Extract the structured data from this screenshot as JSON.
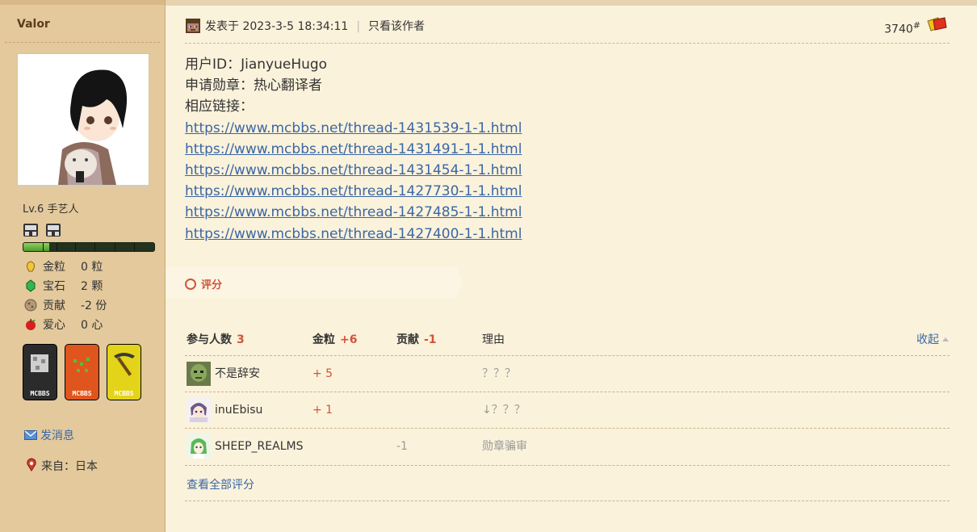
{
  "sidebar": {
    "username": "Valor",
    "level": "Lv.6 手艺人",
    "xp_progress": 0.2,
    "stats": [
      {
        "icon": "gold-nugget-icon",
        "label": "金粒",
        "value": "0 粒"
      },
      {
        "icon": "emerald-icon",
        "label": "宝石",
        "value": "2 颗"
      },
      {
        "icon": "contribution-icon",
        "label": "贡献",
        "value": "-2 份"
      },
      {
        "icon": "apple-icon",
        "label": "爱心",
        "value": "0 心"
      }
    ],
    "medals": [
      {
        "icon": "iron-ore-medal-icon",
        "tag": "MCBBS",
        "color": "#2b2b2b"
      },
      {
        "icon": "redstone-medal-icon",
        "tag": "MCBBS",
        "color": "#e0551e"
      },
      {
        "icon": "pickaxe-medal-icon",
        "tag": "MCBBS",
        "color": "#e4d419"
      }
    ],
    "send_message": "发消息",
    "from_label": "来自：",
    "from_value": "日本"
  },
  "post": {
    "posted_label": "发表于",
    "posted_time": "2023-3-5 18:34:11",
    "only_author": "只看该作者",
    "floor_number": "3740",
    "floor_suffix": "#",
    "lines": [
      "用户ID：JianyueHugo",
      "申请勋章：热心翻译者",
      "相应链接："
    ],
    "links": [
      "https://www.mcbbs.net/thread-1431539-1-1.html",
      "https://www.mcbbs.net/thread-1431491-1-1.html",
      "https://www.mcbbs.net/thread-1431454-1-1.html",
      "https://www.mcbbs.net/thread-1427730-1-1.html",
      "https://www.mcbbs.net/thread-1427485-1-1.html",
      "https://www.mcbbs.net/thread-1427400-1-1.html"
    ]
  },
  "rating": {
    "tab_label": "评分",
    "head": {
      "participants_label": "参与人数",
      "participants_count": "3",
      "gold_label": "金粒",
      "gold_total": "+6",
      "contrib_label": "贡献",
      "contrib_total": "-1",
      "reason_label": "理由"
    },
    "collapse": "收起",
    "rows": [
      {
        "name": "不是辞安",
        "gold": "+ 5",
        "contrib": "",
        "reason": "？？？"
      },
      {
        "name": "inuEbisu",
        "gold": "+ 1",
        "contrib": "",
        "reason": "↓？？？"
      },
      {
        "name": "SHEEP_REALMS",
        "gold": "",
        "contrib": "-1",
        "reason": "勋章骗审"
      }
    ],
    "view_all": "查看全部评分"
  },
  "colors": {
    "sidebar_bg": "#e3c99c",
    "content_bg": "#fbf2db",
    "link": "#3a67a4",
    "accent_red": "#d0543a"
  }
}
